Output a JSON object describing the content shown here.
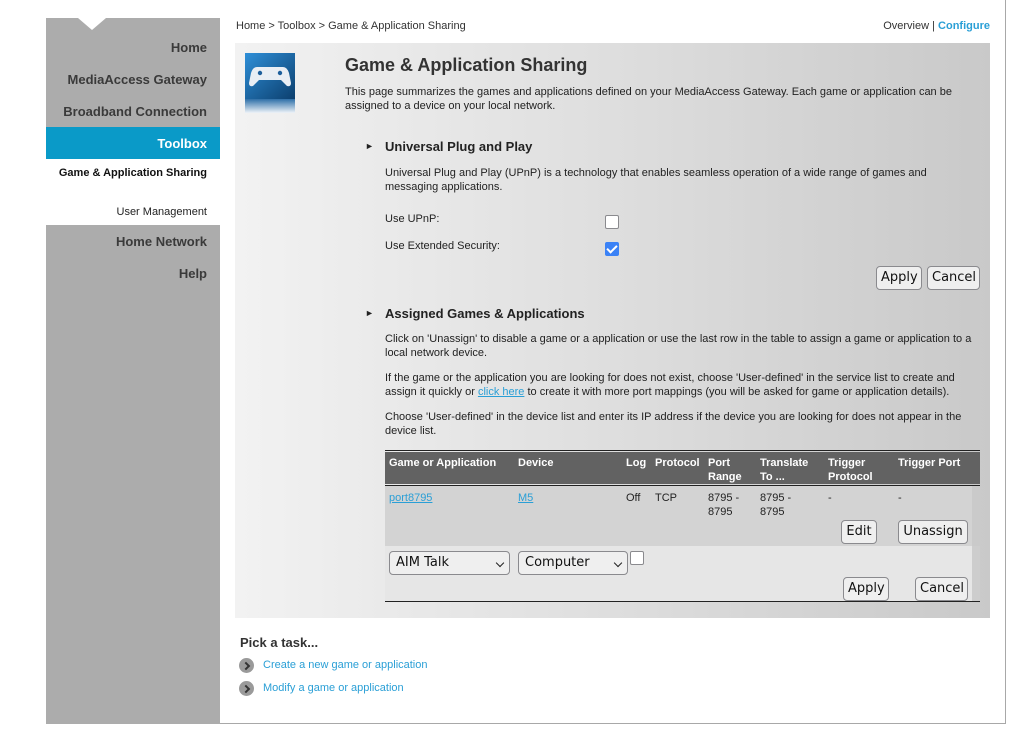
{
  "sidebar": {
    "items": [
      {
        "label": "Home"
      },
      {
        "label": "MediaAccess Gateway"
      },
      {
        "label": "Broadband Connection"
      },
      {
        "label": "Toolbox",
        "active": true
      },
      {
        "label": "Home Network"
      },
      {
        "label": "Help"
      }
    ],
    "subitems": [
      {
        "label": "Game & Application Sharing",
        "active": true
      },
      {
        "label": "User Management"
      }
    ]
  },
  "header": {
    "breadcrumb": "Home > Toolbox > Game & Application Sharing",
    "overview_label": "Overview",
    "separator": "|",
    "configure_label": "Configure"
  },
  "page": {
    "icon": "gamepad-icon",
    "title": "Game & Application Sharing",
    "description": "This page summarizes the games and applications defined on your MediaAccess Gateway. Each game or application can be assigned to a device on your local network."
  },
  "upnp": {
    "title": "Universal Plug and Play",
    "description": "Universal Plug and Play (UPnP) is a technology that enables seamless operation of a wide range of games and messaging applications.",
    "use_upnp_label": "Use UPnP:",
    "use_upnp_checked": false,
    "extended_security_label": "Use Extended Security:",
    "extended_security_checked": true,
    "apply_label": "Apply",
    "cancel_label": "Cancel"
  },
  "assigned": {
    "title": "Assigned Games & Applications",
    "para1": "Click on 'Unassign' to disable a game or a application or use the last row in the table to assign a game or application to a local network device.",
    "para2_before": "If the game or the application you are looking for does not exist, choose 'User-defined' in the service list to create and assign it quickly or ",
    "para2_link": "click here",
    "para2_after": " to create it with more port mappings (you will be asked for game or application details).",
    "para3": "Choose 'User-defined' in the device list and enter its IP address if the device you are looking for does not appear in the device list.",
    "table": {
      "headers": [
        "Game or Application",
        "Device",
        "Log",
        "Protocol",
        "Port Range",
        "Translate To ...",
        "Trigger Protocol",
        "Trigger Port"
      ],
      "rows": [
        {
          "game": "port8795",
          "device": "M5",
          "log": "Off",
          "protocol": "TCP",
          "port_range": "8795 - 8795",
          "translate_to": "8795 - 8795",
          "trigger_protocol": "-",
          "trigger_port": "-",
          "edit_label": "Edit",
          "unassign_label": "Unassign"
        }
      ],
      "new_row": {
        "game_selected": "AIM Talk",
        "device_selected": "Computer",
        "log_checked": false,
        "apply_label": "Apply",
        "cancel_label": "Cancel"
      }
    }
  },
  "tasks": {
    "title": "Pick a task...",
    "items": [
      {
        "label": "Create a new game or application"
      },
      {
        "label": "Modify a game or application"
      }
    ]
  }
}
